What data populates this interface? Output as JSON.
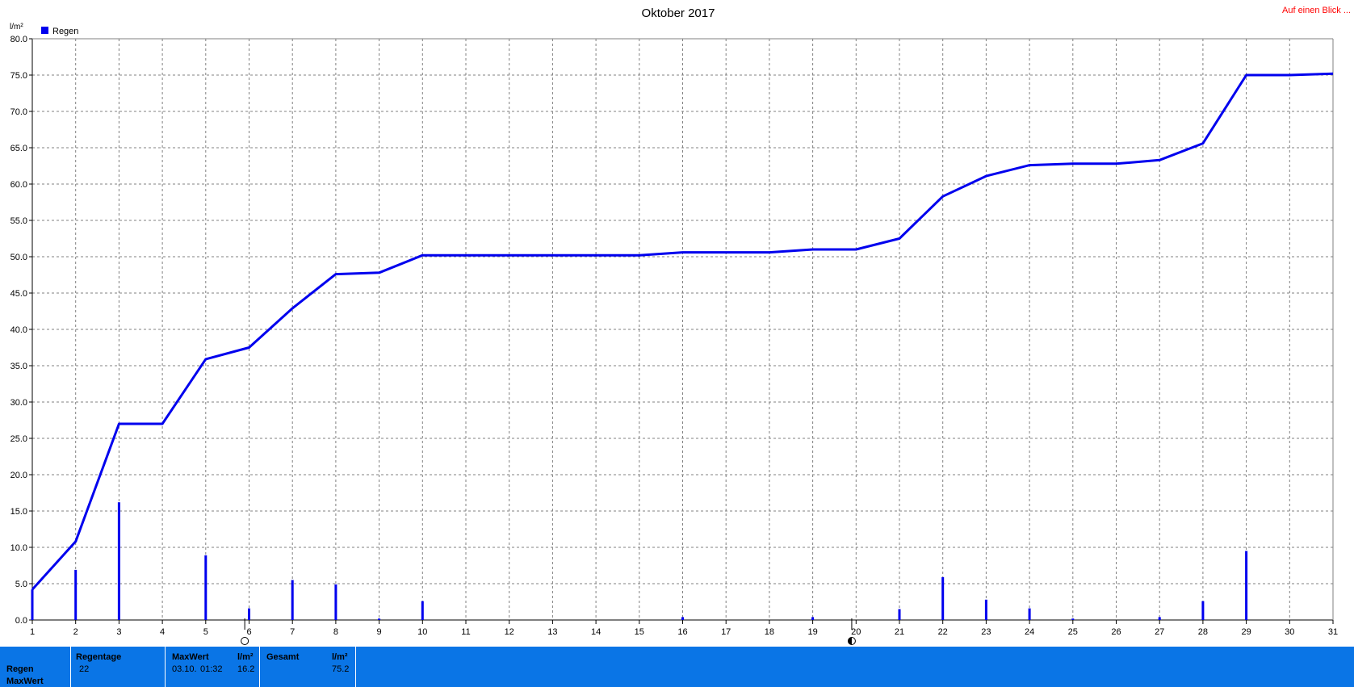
{
  "header": {
    "title": "Oktober 2017",
    "link_label": "Auf einen Blick ..."
  },
  "colors": {
    "series": "#0000ee",
    "panel": "#0a75e6",
    "link": "#ff0000"
  },
  "chart_data": {
    "type": "bar+line",
    "title": "Oktober 2017",
    "ylabel": "l/m²",
    "xlabel": "",
    "ylim": [
      0,
      80
    ],
    "yticks": [
      "0.0",
      "5.0",
      "10.0",
      "15.0",
      "20.0",
      "25.0",
      "30.0",
      "35.0",
      "40.0",
      "45.0",
      "50.0",
      "55.0",
      "60.0",
      "65.0",
      "70.0",
      "75.0",
      "80.0"
    ],
    "x": [
      1,
      2,
      3,
      4,
      5,
      6,
      7,
      8,
      9,
      10,
      11,
      12,
      13,
      14,
      15,
      16,
      17,
      18,
      19,
      20,
      21,
      22,
      23,
      24,
      25,
      26,
      27,
      28,
      29,
      30,
      31
    ],
    "grid": true,
    "legend": {
      "position": "top-left",
      "entries": [
        "Regen"
      ]
    },
    "series": [
      {
        "name": "Regen",
        "kind": "bar",
        "points": [
          [
            1,
            4.2
          ],
          [
            2,
            6.9
          ],
          [
            3,
            16.2
          ],
          [
            5,
            8.9
          ],
          [
            6,
            1.6
          ],
          [
            7,
            5.5
          ],
          [
            8,
            4.9
          ],
          [
            9,
            0.2
          ],
          [
            10,
            2.6
          ],
          [
            16,
            0.4
          ],
          [
            19,
            0.4
          ],
          [
            21,
            1.5
          ],
          [
            22,
            5.9
          ],
          [
            23,
            2.8
          ],
          [
            24,
            1.6
          ],
          [
            25,
            0.2
          ],
          [
            27,
            0.4
          ],
          [
            28,
            2.6
          ],
          [
            29,
            9.5
          ]
        ]
      },
      {
        "kind": "line",
        "points": [
          [
            1,
            4.2
          ],
          [
            2,
            10.8
          ],
          [
            3,
            27.0
          ],
          [
            4,
            27.0
          ],
          [
            5,
            35.9
          ],
          [
            6,
            37.5
          ],
          [
            7,
            42.9
          ],
          [
            8,
            47.6
          ],
          [
            9,
            47.8
          ],
          [
            10,
            50.2
          ],
          [
            11,
            50.2
          ],
          [
            12,
            50.2
          ],
          [
            13,
            50.2
          ],
          [
            14,
            50.2
          ],
          [
            15,
            50.2
          ],
          [
            16,
            50.6
          ],
          [
            17,
            50.6
          ],
          [
            18,
            50.6
          ],
          [
            19,
            51.0
          ],
          [
            20,
            51.0
          ],
          [
            21,
            52.5
          ],
          [
            22,
            58.3
          ],
          [
            23,
            61.1
          ],
          [
            24,
            62.6
          ],
          [
            25,
            62.8
          ],
          [
            26,
            62.8
          ],
          [
            27,
            63.3
          ],
          [
            28,
            65.6
          ],
          [
            29,
            75.0
          ],
          [
            30,
            75.0
          ],
          [
            31,
            75.2
          ]
        ]
      }
    ],
    "moon_markers": [
      {
        "day": 5.9,
        "phase": "full-moon"
      },
      {
        "day": 19.9,
        "phase": "new-moon"
      }
    ]
  },
  "stats": {
    "row_labels": [
      "Regen",
      "MaxWert"
    ],
    "regentage_label": "Regentage",
    "regentage_value": "22",
    "maxwert_label": "MaxWert",
    "maxwert_unit": "l/m²",
    "maxwert_date": "03.10.",
    "maxwert_time": "01:32",
    "maxwert_value": "16.2",
    "gesamt_label": "Gesamt",
    "gesamt_unit": "l/m²",
    "gesamt_value": "75.2"
  }
}
